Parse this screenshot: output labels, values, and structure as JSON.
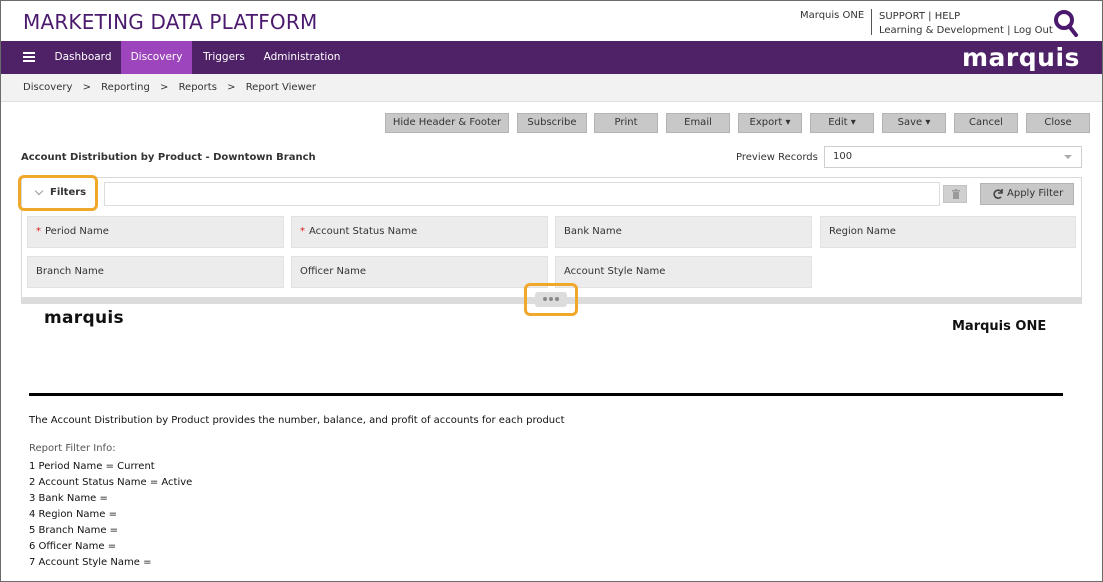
{
  "app": {
    "title": "MARKETING DATA PLATFORM",
    "user": "Marquis ONE",
    "support_label": "SUPPORT",
    "help_label": "HELP",
    "learning_label": "Learning & Development",
    "logout_label": "Log Out",
    "separator": "|",
    "brand": "marquis",
    "accent_color": "#4f2267",
    "active_tab_color": "#9c45bc",
    "highlight_color": "#f0a82a"
  },
  "nav": {
    "items": [
      {
        "label": "Dashboard"
      },
      {
        "label": "Discovery",
        "active": true
      },
      {
        "label": "Triggers"
      },
      {
        "label": "Administration"
      }
    ]
  },
  "breadcrumb": {
    "items": [
      "Discovery",
      "Reporting",
      "Reports",
      "Report Viewer"
    ],
    "separator": ">"
  },
  "toolbar": {
    "hide_header_footer": "Hide Header & Footer",
    "subscribe": "Subscribe",
    "print": "Print",
    "email": "Email",
    "export": "Export",
    "edit": "Edit",
    "save": "Save",
    "cancel": "Cancel",
    "close": "Close"
  },
  "report": {
    "title": "Account Distribution by Product - Downtown Branch",
    "preview_label": "Preview Records",
    "preview_value": "100",
    "logo": "marquis",
    "brand_title": "Marquis ONE",
    "description": "The Account Distribution by Product provides the number, balance, and profit of accounts for each product",
    "filter_info_title": "Report Filter Info:",
    "filter_info": [
      "1 Period Name = Current",
      "2 Account Status Name = Active",
      "3 Bank Name =",
      "4 Region Name =",
      "5 Branch Name =",
      "6 Officer Name =",
      "7 Account Style Name ="
    ]
  },
  "filters": {
    "label": "Filters",
    "apply_label": "Apply Filter",
    "required_mark": "*",
    "fields": [
      {
        "label": "Period Name",
        "required": true
      },
      {
        "label": "Account Status Name",
        "required": true
      },
      {
        "label": "Bank Name",
        "required": false
      },
      {
        "label": "Region Name",
        "required": false
      },
      {
        "label": "Branch Name",
        "required": false
      },
      {
        "label": "Officer Name",
        "required": false
      },
      {
        "label": "Account Style Name",
        "required": false
      }
    ]
  }
}
